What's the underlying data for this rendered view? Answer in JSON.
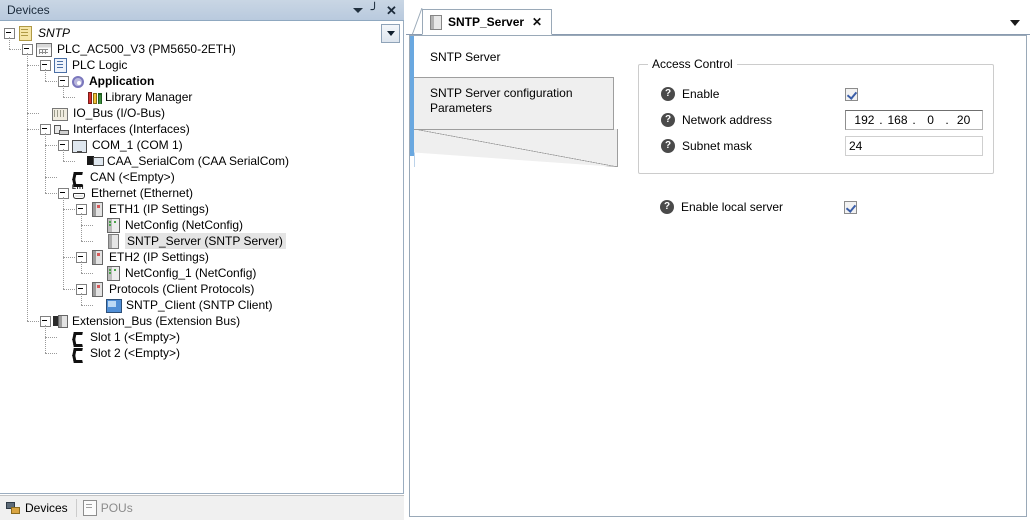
{
  "devices_panel": {
    "title": "Devices",
    "header_buttons": [
      {
        "name": "dropdown-caret",
        "label": "▾"
      },
      {
        "name": "pin",
        "label": "⊥"
      },
      {
        "name": "close",
        "label": "✕"
      }
    ],
    "tree": [
      {
        "label": "SNTP",
        "icon": "project-icon",
        "depth": 0,
        "expander": true,
        "style": "italic"
      },
      {
        "label": "PLC_AC500_V3 (PM5650-2ETH)",
        "icon": "plc-icon",
        "depth": 1,
        "expander": true,
        "style": "normal"
      },
      {
        "label": "PLC Logic",
        "icon": "plc-logic-icon",
        "depth": 2,
        "expander": true,
        "style": "normal"
      },
      {
        "label": "Application",
        "icon": "application-icon",
        "depth": 3,
        "expander": true,
        "style": "bold"
      },
      {
        "label": "Library Manager",
        "icon": "library-manager-icon",
        "depth": 4,
        "expander": false,
        "style": "normal"
      },
      {
        "label": "IO_Bus (I/O-Bus)",
        "icon": "io-bus-icon",
        "depth": 2,
        "expander": false,
        "style": "normal"
      },
      {
        "label": "Interfaces (Interfaces)",
        "icon": "interfaces-icon",
        "depth": 2,
        "expander": true,
        "style": "normal"
      },
      {
        "label": "COM_1 (COM 1)",
        "icon": "com-port-icon",
        "depth": 3,
        "expander": true,
        "style": "normal"
      },
      {
        "label": "CAA_SerialCom (CAA SerialCom)",
        "icon": "serial-com-icon",
        "depth": 4,
        "expander": false,
        "style": "normal"
      },
      {
        "label": "CAN (<Empty>)",
        "icon": "can-empty-icon",
        "depth": 3,
        "expander": false,
        "style": "normal"
      },
      {
        "label": "Ethernet (Ethernet)",
        "icon": "ethernet-icon",
        "depth": 3,
        "expander": true,
        "style": "normal"
      },
      {
        "label": "ETH1 (IP Settings)",
        "icon": "ip-settings-icon",
        "depth": 4,
        "expander": true,
        "style": "normal"
      },
      {
        "label": "NetConfig (NetConfig)",
        "icon": "netconfig-icon",
        "depth": 5,
        "expander": false,
        "style": "normal"
      },
      {
        "label": "SNTP_Server (SNTP Server)",
        "icon": "sntp-server-icon",
        "depth": 5,
        "expander": false,
        "style": "normal",
        "selected": true
      },
      {
        "label": "ETH2 (IP Settings)",
        "icon": "ip-settings-icon",
        "depth": 4,
        "expander": true,
        "style": "normal"
      },
      {
        "label": "NetConfig_1 (NetConfig)",
        "icon": "netconfig-icon",
        "depth": 5,
        "expander": false,
        "style": "normal"
      },
      {
        "label": "Protocols (Client Protocols)",
        "icon": "protocols-icon",
        "depth": 4,
        "expander": true,
        "style": "normal"
      },
      {
        "label": "SNTP_Client (SNTP Client)",
        "icon": "sntp-client-icon",
        "depth": 5,
        "expander": false,
        "style": "normal"
      },
      {
        "label": "Extension_Bus (Extension Bus)",
        "icon": "extension-bus-icon",
        "depth": 2,
        "expander": true,
        "style": "normal"
      },
      {
        "label": "Slot 1 (<Empty>)",
        "icon": "slot-empty-icon",
        "depth": 3,
        "expander": false,
        "style": "normal"
      },
      {
        "label": "Slot 2 (<Empty>)",
        "icon": "slot-empty-icon",
        "depth": 3,
        "expander": false,
        "style": "normal"
      }
    ]
  },
  "bottom_tabs": [
    {
      "label": "Devices",
      "active": true,
      "icon": "devices-tab-icon"
    },
    {
      "label": "POUs",
      "active": false,
      "icon": "pous-tab-icon"
    }
  ],
  "editor": {
    "tab": {
      "title": "SNTP_Server",
      "close_label": "✕",
      "icon": "server-icon"
    },
    "vertical_tabs": [
      {
        "label": "SNTP Server",
        "active": false
      },
      {
        "label": "SNTP Server configuration Parameters",
        "active": true
      }
    ],
    "form": {
      "group_title": "Access Control",
      "rows": [
        {
          "label": "Enable",
          "type": "checkbox",
          "checked": true,
          "help": "?"
        },
        {
          "label": "Network address",
          "type": "ip",
          "help": "?",
          "ip": {
            "o1": "192",
            "o2": "168",
            "o3": "0",
            "o4": "20",
            "sep": "."
          }
        },
        {
          "label": "Subnet mask",
          "type": "text",
          "value": "24",
          "help": "?"
        }
      ],
      "outside_row": {
        "label": "Enable local server",
        "type": "checkbox",
        "checked": true,
        "help": "?"
      }
    }
  },
  "colors": {
    "panel_header": "#c9d6e4",
    "accent_blue": "#6aa8e0",
    "selection_gray": "#e4e4e4",
    "check_blue": "#3b5ea8",
    "help_icon": "#4a4a4a"
  }
}
